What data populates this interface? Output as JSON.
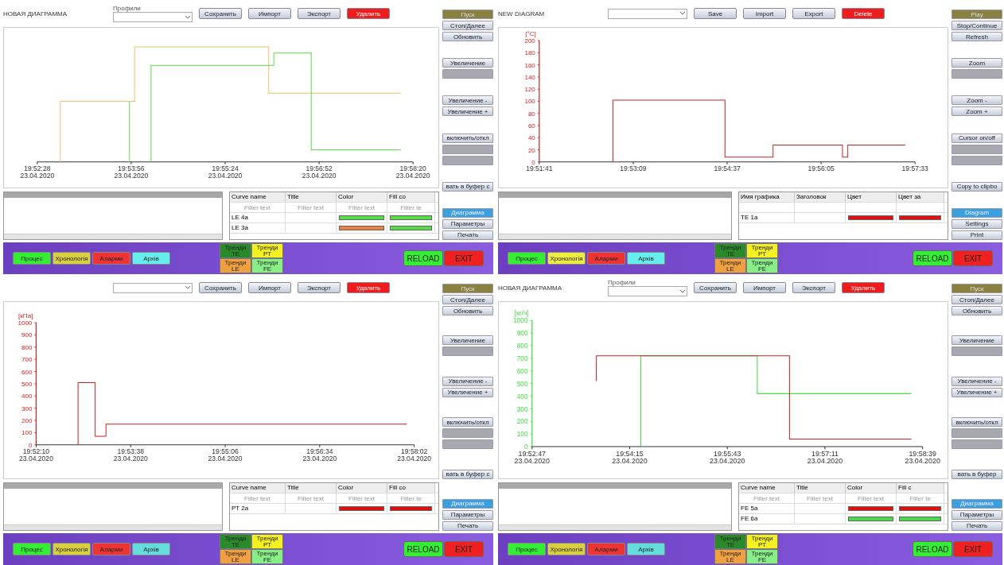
{
  "panels": [
    {
      "title": "НОВАЯ ДИАГРАММА",
      "profile_label": "Профили",
      "header_buttons": [
        {
          "label": "Сохранить",
          "kind": "normal"
        },
        {
          "label": "Импорт",
          "kind": "normal"
        },
        {
          "label": "Экспорт",
          "kind": "normal"
        },
        {
          "label": "Удалить",
          "kind": "danger"
        }
      ],
      "chart": {
        "x_labels": [
          "19:52:28\n23.04.2020",
          "19:53:56\n23.04.2020",
          "19:55:24\n23.04.2020",
          "19:56:52\n23.04.2020",
          "19:58:20\n23.04.2020"
        ]
      },
      "side": [
        [
          {
            "label": "Пуск",
            "kind": "play"
          },
          {
            "label": "Стоп/Далее",
            "kind": "button"
          },
          {
            "label": "Обновить",
            "kind": "button"
          }
        ],
        [
          {
            "label": "Увеличение",
            "kind": "button"
          },
          {
            "kind": "disabled"
          }
        ],
        [
          {
            "label": "Увеличение -",
            "kind": "button"
          },
          {
            "label": "Увеличение +",
            "kind": "button"
          }
        ],
        [
          {
            "label": "включить/откл",
            "kind": "button"
          },
          {
            "kind": "disabled"
          },
          {
            "kind": "disabled"
          }
        ],
        [
          {
            "label": "вать в буфер с",
            "kind": "button"
          }
        ],
        [
          {
            "label": "Диаграмма",
            "kind": "tab",
            "selected": true
          },
          {
            "label": "Параметры",
            "kind": "tab",
            "selected": false
          },
          {
            "label": "Печать",
            "kind": "tab",
            "selected": false
          }
        ]
      ],
      "table": {
        "columns": [
          {
            "label": "Curve name",
            "placeholder": "Filter text"
          },
          {
            "label": "Title",
            "placeholder": "Filter text"
          },
          {
            "label": "Color",
            "placeholder": "Filter text"
          },
          {
            "label": "Fill co",
            "placeholder": "Filter te"
          }
        ],
        "rows": [
          {
            "name": "LE 4a",
            "swatches": [
              {
                "color": "#55dd44"
              },
              {
                "color": "#55dd44"
              }
            ]
          },
          {
            "name": "LE 3a",
            "swatches": [
              {
                "color": "#f08040"
              },
              {
                "color": "#55dd44"
              }
            ]
          }
        ]
      },
      "footer": {
        "nav": [
          {
            "label": "Процес",
            "color": "#33ee33"
          },
          {
            "label": "Хронологія",
            "color": "#d8d040"
          },
          {
            "label": "Аларми",
            "color": "#ee3333"
          },
          {
            "label": "Архів",
            "color": "#66eeee"
          }
        ],
        "trends": [
          {
            "label": "Тренди TE",
            "color": "#2a8a2a"
          },
          {
            "label": "Тренди PT",
            "color": "#f5f020"
          },
          {
            "label": "Тренди LE",
            "color": "#f0a040"
          },
          {
            "label": "Тренди FE",
            "color": "#88ee88"
          }
        ],
        "actions": [
          {
            "label": "RELOAD",
            "color": "#33ee33"
          },
          {
            "label": "EXIT",
            "color": "#ee2020"
          }
        ]
      }
    },
    {
      "title": "NEW DIAGRAM",
      "header_buttons": [
        {
          "label": "Save",
          "kind": "normal"
        },
        {
          "label": "Import",
          "kind": "normal"
        },
        {
          "label": "Export",
          "kind": "normal"
        },
        {
          "label": "Delete",
          "kind": "danger"
        }
      ],
      "chart_data": {
        "type": "line",
        "ylabel": "[°C]",
        "x": [
          71570,
          71570,
          71675,
          71675,
          71720,
          71720,
          71785,
          71785,
          71790,
          71790,
          71844
        ],
        "series": [
          {
            "color": "#cc2222",
            "values": [
              0,
              102,
              102,
              8,
              8,
              28,
              28,
              8,
              8,
              28,
              28
            ]
          }
        ],
        "xlim": [
          71501,
          71853
        ],
        "ylim": [
          0,
          200
        ],
        "xticks": [
          {
            "value": 71501,
            "label": "19:51:41"
          },
          {
            "value": 71589,
            "label": "19:53:09"
          },
          {
            "value": 71677,
            "label": "19:54:37"
          },
          {
            "value": 71765,
            "label": "19:56:05"
          },
          {
            "value": 71853,
            "label": "19:57:33"
          }
        ],
        "yticks": [
          0,
          20,
          40,
          60,
          80,
          100,
          120,
          140,
          160,
          180,
          200
        ]
      },
      "side": [
        [
          {
            "label": "Play",
            "kind": "play"
          },
          {
            "label": "Stop/Continue",
            "kind": "button"
          },
          {
            "label": "Refresh",
            "kind": "button"
          }
        ],
        [
          {
            "label": "Zoom",
            "kind": "button"
          },
          {
            "kind": "disabled"
          }
        ],
        [
          {
            "label": "Zoom -",
            "kind": "button"
          },
          {
            "label": "Zoom +",
            "kind": "button"
          }
        ],
        [
          {
            "label": "Cursor on/off",
            "kind": "button"
          },
          {
            "kind": "disabled"
          },
          {
            "kind": "disabled"
          }
        ],
        [
          {
            "label": "Copy to clipbo",
            "kind": "button"
          }
        ],
        [
          {
            "label": "Diagram",
            "kind": "tab",
            "selected": true
          },
          {
            "label": "Settings",
            "kind": "tab",
            "selected": false
          },
          {
            "label": "Print",
            "kind": "tab",
            "selected": false
          }
        ]
      ],
      "table": {
        "columns": [
          {
            "label": "Имя графика"
          },
          {
            "label": "Заголовок"
          },
          {
            "label": "Цвет"
          },
          {
            "label": "Цвет за"
          }
        ],
        "rows": [
          {
            "name": "TE 1a",
            "swatches": [
              {
                "color": "#dd1111"
              },
              {
                "color": "#dd1111"
              }
            ]
          }
        ]
      },
      "footer": {
        "nav": [
          {
            "label": "Процес",
            "color": "#33ee33"
          },
          {
            "label": "Хронологія",
            "color": "#eeee40"
          },
          {
            "label": "Аларми",
            "color": "#ee3333"
          },
          {
            "label": "Архів",
            "color": "#66eeee"
          }
        ],
        "trends": [
          {
            "label": "Тренди TE",
            "color": "#2a8a2a"
          },
          {
            "label": "Тренди PT",
            "color": "#f5f020"
          },
          {
            "label": "Тренди LE",
            "color": "#f0a040"
          },
          {
            "label": "Тренди FE",
            "color": "#88ee88"
          }
        ],
        "actions": [
          {
            "label": "RELOAD",
            "color": "#33ee33"
          },
          {
            "label": "EXIT",
            "color": "#ee2020"
          }
        ]
      }
    },
    {
      "header_buttons": [
        {
          "label": "Сохранить",
          "kind": "normal"
        },
        {
          "label": "Импорт",
          "kind": "normal"
        },
        {
          "label": "Экспорт",
          "kind": "normal"
        },
        {
          "label": "Удалить",
          "kind": "danger"
        }
      ],
      "x_dates": [
        "23.04.2020",
        "23.04.2020",
        "23.04.2020",
        "23.04.2020",
        "23.04.2020"
      ],
      "chart_data": {
        "type": "line",
        "ylabel": "[кПа]",
        "x": [
          71569,
          71569,
          71585,
          71585,
          71595,
          71595,
          71875
        ],
        "series": [
          {
            "color": "#cc2222",
            "values": [
              0,
              510,
              510,
              70,
              70,
              170,
              170
            ]
          }
        ],
        "xlim": [
          71530,
          71882
        ],
        "ylim": [
          0,
          1000
        ],
        "xticks": [
          {
            "value": 71530,
            "label": "19:52:10"
          },
          {
            "value": 71618,
            "label": "19:53:38"
          },
          {
            "value": 71706,
            "label": "19:55:06"
          },
          {
            "value": 71794,
            "label": "19:56:34"
          },
          {
            "value": 71882,
            "label": "19:58:02"
          }
        ],
        "yticks": [
          0,
          100,
          200,
          300,
          400,
          500,
          600,
          700,
          800,
          900,
          1000
        ]
      },
      "side": [
        [
          {
            "label": "Пуск",
            "kind": "play"
          },
          {
            "label": "Стоп/Далее",
            "kind": "button"
          },
          {
            "label": "Обновить",
            "kind": "button"
          }
        ],
        [
          {
            "label": "Увеличение",
            "kind": "button"
          },
          {
            "kind": "disabled"
          }
        ],
        [
          {
            "label": "Увеличение -",
            "kind": "button"
          },
          {
            "label": "Увеличение +",
            "kind": "button"
          }
        ],
        [
          {
            "label": "включить/откл",
            "kind": "button"
          },
          {
            "kind": "disabled"
          },
          {
            "kind": "disabled"
          }
        ],
        [
          {
            "label": "вать в буфер с",
            "kind": "button"
          }
        ],
        [
          {
            "label": "Диаграмма",
            "kind": "tab",
            "selected": true
          },
          {
            "label": "Параметры",
            "kind": "tab",
            "selected": false
          },
          {
            "label": "Печать",
            "kind": "tab",
            "selected": false
          }
        ]
      ],
      "table": {
        "columns": [
          {
            "label": "Curve name",
            "placeholder": "Filter text"
          },
          {
            "label": "Title",
            "placeholder": "Filter text"
          },
          {
            "label": "Color",
            "placeholder": "Filter text"
          },
          {
            "label": "Fill co",
            "placeholder": "Filter te"
          }
        ],
        "rows": [
          {
            "name": "PT 2a",
            "swatches": [
              {
                "color": "#dd1111"
              },
              {
                "color": "#dd1111"
              }
            ]
          }
        ]
      },
      "footer": {
        "nav": [
          {
            "label": "Процес",
            "color": "#33ee33"
          },
          {
            "label": "Хронологія",
            "color": "#d8d040"
          },
          {
            "label": "Аларми",
            "color": "#ee3333"
          },
          {
            "label": "Архів",
            "color": "#66dddd"
          }
        ],
        "trends": [
          {
            "label": "Тренди TE",
            "color": "#2a8a2a"
          },
          {
            "label": "Тренди PT",
            "color": "#f5f020"
          },
          {
            "label": "Тренди LE",
            "color": "#f0a040"
          },
          {
            "label": "Тренди FE",
            "color": "#88ee88"
          }
        ],
        "actions": [
          {
            "label": "RELOAD",
            "color": "#33ee33"
          },
          {
            "label": "EXIT",
            "color": "#ee2020"
          }
        ]
      }
    },
    {
      "title": "НОВАЯ ДИАГРАММА",
      "profile_label": "Профили",
      "header_buttons": [
        {
          "label": "Сохранить",
          "kind": "normal"
        },
        {
          "label": "Импорт",
          "kind": "normal"
        },
        {
          "label": "Экспорт",
          "kind": "normal"
        },
        {
          "label": "Удалить",
          "kind": "danger"
        }
      ],
      "x_dates": [
        "23.04.2020",
        "23.04.2020",
        "23.04.2020",
        "23.04.2020",
        "23.04.2020"
      ],
      "chart_data": {
        "type": "line",
        "ylabel": "[кг/ч]",
        "x": [
          71625,
          71625,
          71665,
          71665,
          71770,
          71770,
          71799,
          71799,
          71909
        ],
        "series": [
          {
            "color": "#44dd44",
            "values": [
              null,
              null,
              0,
              720,
              720,
              420,
              420,
              420,
              420
            ]
          },
          {
            "color": "#cc2222",
            "values": [
              520,
              720,
              720,
              720,
              720,
              720,
              720,
              60,
              60
            ]
          }
        ],
        "xlim": [
          71567,
          71919
        ],
        "ylim": [
          0,
          1000
        ],
        "xticks": [
          {
            "value": 71567,
            "label": "19:52:47"
          },
          {
            "value": 71655,
            "label": "19:54:15"
          },
          {
            "value": 71743,
            "label": "19:55:43"
          },
          {
            "value": 71831,
            "label": "19:57:11"
          },
          {
            "value": 71919,
            "label": "19:58:39"
          }
        ],
        "yticks": [
          0,
          100,
          200,
          300,
          400,
          500,
          600,
          700,
          800,
          900,
          1000
        ]
      },
      "side": [
        [
          {
            "label": "Пуск",
            "kind": "play"
          },
          {
            "label": "Стоп/Далее",
            "kind": "button"
          },
          {
            "label": "Обновить",
            "kind": "button"
          }
        ],
        [
          {
            "label": "Увеличение",
            "kind": "button"
          },
          {
            "kind": "disabled"
          }
        ],
        [
          {
            "label": "Увеличение -",
            "kind": "button"
          },
          {
            "label": "Увеличение +",
            "kind": "button"
          }
        ],
        [
          {
            "label": "включить/откл",
            "kind": "button"
          },
          {
            "kind": "disabled"
          },
          {
            "kind": "disabled"
          }
        ],
        [
          {
            "label": "вать в буфер",
            "kind": "button"
          }
        ],
        [
          {
            "label": "Диаграмма",
            "kind": "tab",
            "selected": true
          },
          {
            "label": "Параметры",
            "kind": "tab",
            "selected": false
          },
          {
            "label": "Печать",
            "kind": "tab",
            "selected": false
          }
        ]
      ],
      "table": {
        "columns": [
          {
            "label": "Curve name",
            "placeholder": "Filter text"
          },
          {
            "label": "Title",
            "placeholder": "Filter text"
          },
          {
            "label": "Color",
            "placeholder": "Filter text"
          },
          {
            "label": "Fill c",
            "placeholder": "Filter te"
          }
        ],
        "rows": [
          {
            "name": "FE 5a",
            "swatches": [
              {
                "color": "#dd1111"
              },
              {
                "color": "#dd1111"
              }
            ]
          },
          {
            "name": "FE 6a",
            "swatches": [
              {
                "color": "#44dd44"
              },
              {
                "color": "#44dd44"
              }
            ]
          }
        ]
      },
      "footer": {
        "nav": [
          {
            "label": "Процес",
            "color": "#33ee33"
          },
          {
            "label": "Хронологія",
            "color": "#d8d040"
          },
          {
            "label": "Аларми",
            "color": "#ee3333"
          },
          {
            "label": "Архів",
            "color": "#66dddd"
          }
        ],
        "trends": [
          {
            "label": "Тренди TE",
            "color": "#2a8a2a"
          },
          {
            "label": "Тренди PT",
            "color": "#f5f020"
          },
          {
            "label": "Тренди LE",
            "color": "#f0a040"
          },
          {
            "label": "Тренди FE",
            "color": "#88ee88"
          }
        ],
        "actions": [
          {
            "label": "RELOAD",
            "color": "#33ee33"
          },
          {
            "label": "EXIT",
            "color": "#ee2020"
          }
        ]
      }
    }
  ]
}
